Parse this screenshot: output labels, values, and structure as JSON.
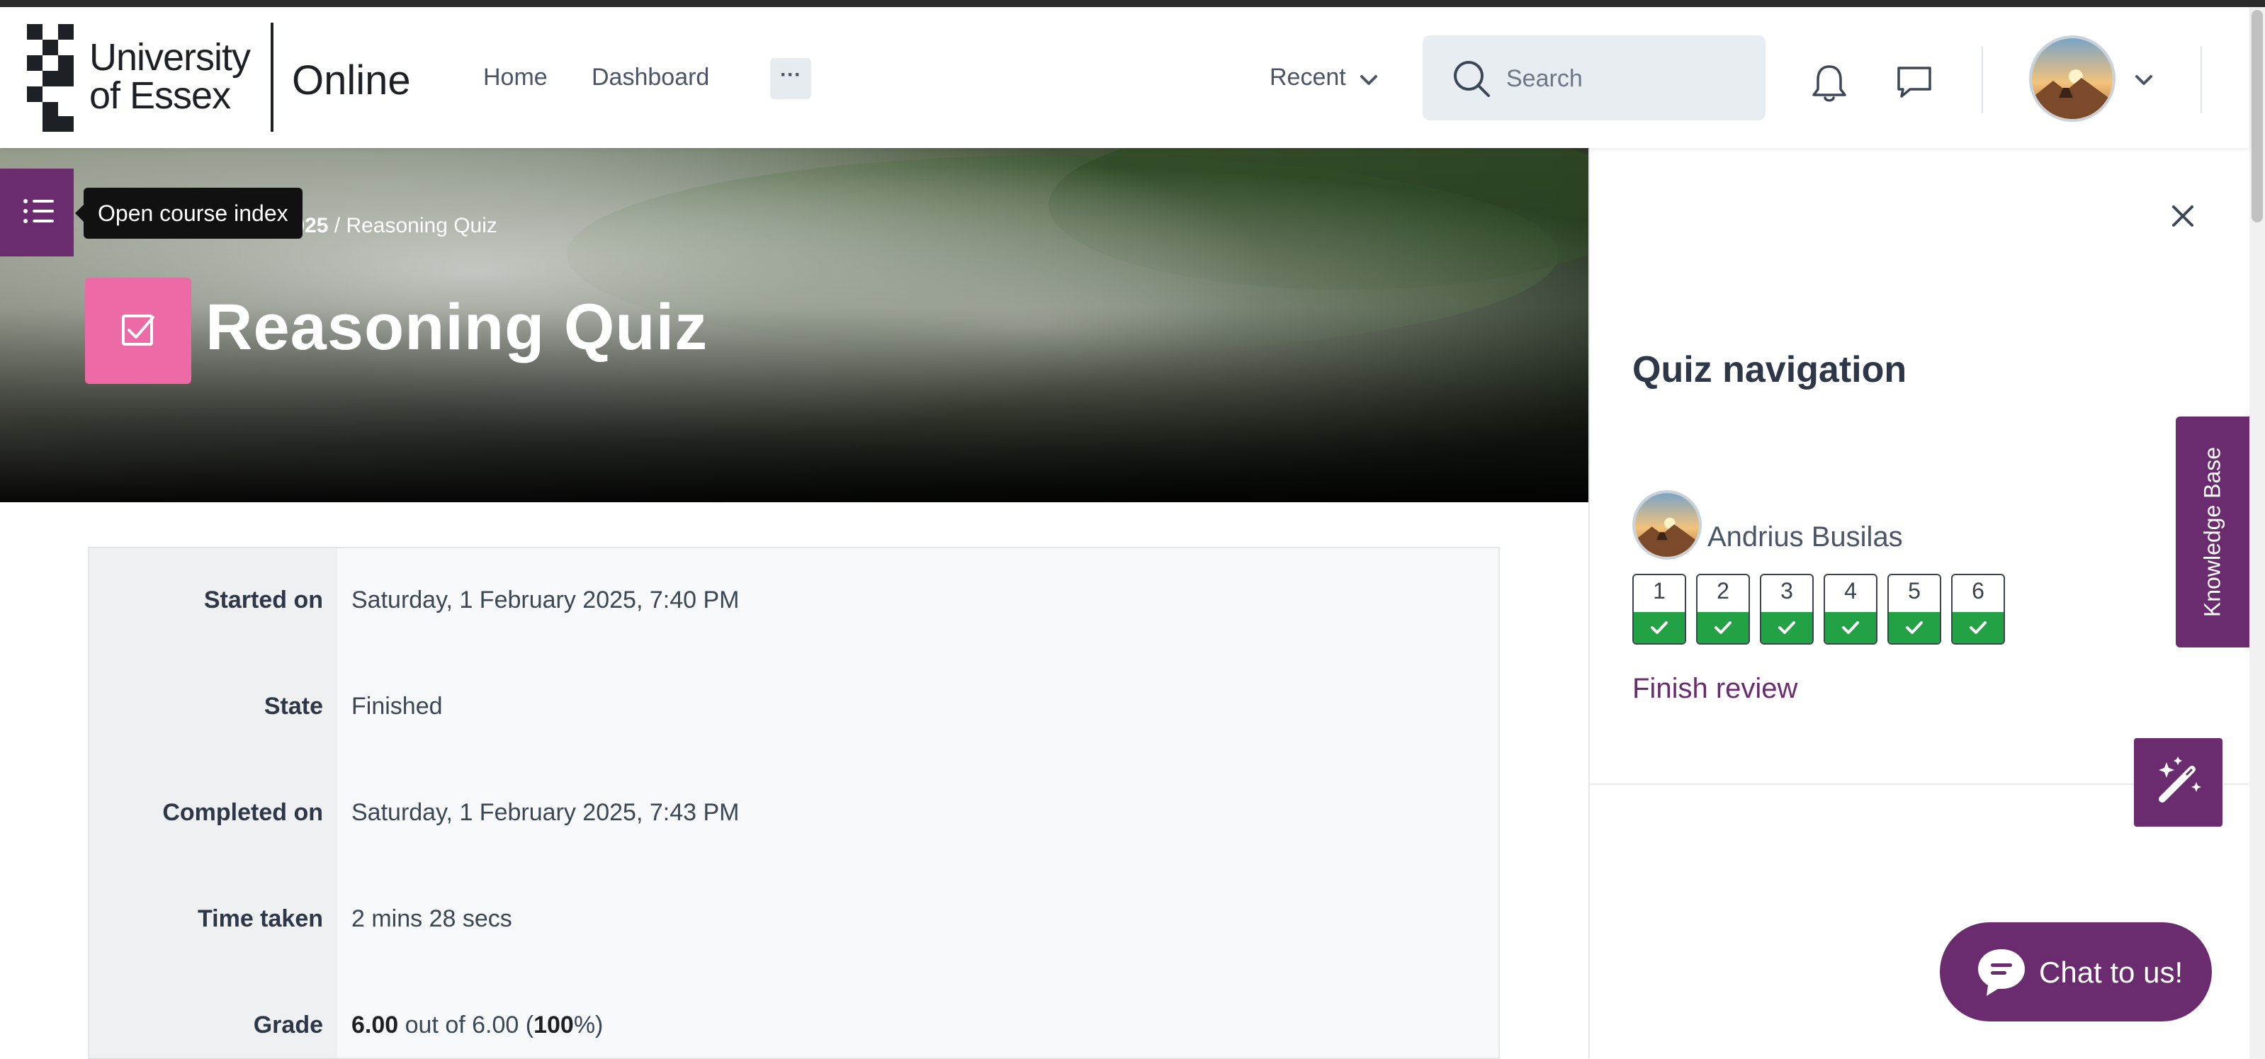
{
  "header": {
    "logo_line1": "University",
    "logo_line2": "of Essex",
    "logo_online": "Online",
    "nav": [
      "Home",
      "Dashboard"
    ],
    "more_label": "···",
    "recent_label": "Recent",
    "search_placeholder": "Search"
  },
  "course_index": {
    "tooltip": "Open course index"
  },
  "breadcrumb": {
    "course": "ry 2025",
    "current": "/ Reasoning Quiz"
  },
  "page": {
    "title": "Reasoning Quiz"
  },
  "summary": {
    "rows": [
      {
        "label": "Started on",
        "value": "Saturday, 1 February 2025, 7:40 PM"
      },
      {
        "label": "State",
        "value": "Finished"
      },
      {
        "label": "Completed on",
        "value": "Saturday, 1 February 2025, 7:43 PM"
      },
      {
        "label": "Time taken",
        "value": "2 mins 28 secs"
      }
    ],
    "grade": {
      "label": "Grade",
      "score": "6.00",
      "mid": " out of 6.00 (",
      "percent": "100",
      "end": "%)"
    }
  },
  "drawer": {
    "title": "Quiz navigation",
    "user_name": "Andrius Busilas",
    "questions": [
      "1",
      "2",
      "3",
      "4",
      "5",
      "6"
    ],
    "finish_label": "Finish review"
  },
  "floating": {
    "knowledge_base": "Knowledge Base",
    "chat_label": "Chat to us!"
  },
  "colors": {
    "brand_purple": "#6a2c6f",
    "quiz_pink": "#ec6aa6",
    "correct_green": "#22a244"
  }
}
